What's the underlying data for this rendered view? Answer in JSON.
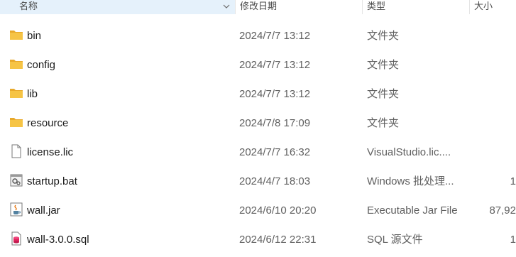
{
  "columns": {
    "name": "名称",
    "date": "修改日期",
    "type": "类型",
    "size": "大小"
  },
  "files": [
    {
      "name": "bin",
      "date": "2024/7/7 13:12",
      "type": "文件夹",
      "size": "",
      "icon": "folder-icon"
    },
    {
      "name": "config",
      "date": "2024/7/7 13:12",
      "type": "文件夹",
      "size": "",
      "icon": "folder-icon"
    },
    {
      "name": "lib",
      "date": "2024/7/7 13:12",
      "type": "文件夹",
      "size": "",
      "icon": "folder-icon"
    },
    {
      "name": "resource",
      "date": "2024/7/8 17:09",
      "type": "文件夹",
      "size": "",
      "icon": "folder-icon"
    },
    {
      "name": "license.lic",
      "date": "2024/7/7 16:32",
      "type": "VisualStudio.lic....",
      "size": "",
      "icon": "document-icon"
    },
    {
      "name": "startup.bat",
      "date": "2024/4/7 18:03",
      "type": "Windows 批处理...",
      "size": "1",
      "icon": "batch-file-icon"
    },
    {
      "name": "wall.jar",
      "date": "2024/6/10 20:20",
      "type": "Executable Jar File",
      "size": "87,92",
      "icon": "java-jar-icon"
    },
    {
      "name": "wall-3.0.0.sql",
      "date": "2024/6/12 22:31",
      "type": "SQL 源文件",
      "size": "1",
      "icon": "sql-file-icon"
    }
  ],
  "colors": {
    "header_active_bg": "#e5f1fb",
    "folder_yellow": "#f6c445",
    "secondary_text": "#5f5f5f"
  }
}
